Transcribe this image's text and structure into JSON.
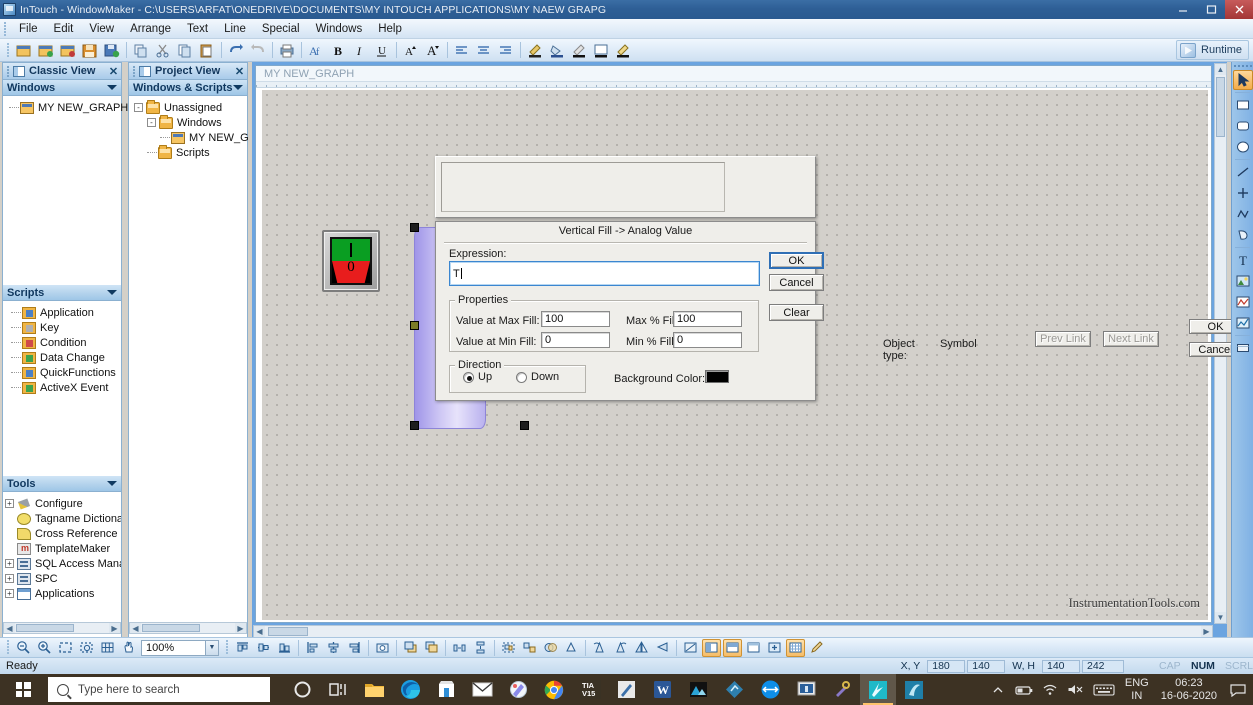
{
  "window": {
    "title": "InTouch - WindowMaker - C:\\USERS\\ARFAT\\ONEDRIVE\\DOCUMENTS\\MY INTOUCH APPLICATIONS\\MY NAEW GRAPG",
    "minimize": "–",
    "maximize": "❐",
    "close": "✕"
  },
  "menu": {
    "items": [
      "File",
      "Edit",
      "View",
      "Arrange",
      "Text",
      "Line",
      "Special",
      "Windows",
      "Help"
    ]
  },
  "toolbar": {
    "runtime_label": "Runtime",
    "icons": [
      "new-window-icon",
      "open-window-icon",
      "close-window-icon",
      "save-icon",
      "save-all-icon",
      "duplicate-icon",
      "cut-icon",
      "copy-icon",
      "paste-icon",
      "undo-icon",
      "redo-icon",
      "print-icon",
      "font-icon",
      "bold-icon",
      "italic-icon",
      "underline-icon",
      "increase-font-icon",
      "decrease-font-icon",
      "align-left-icon",
      "align-center-icon",
      "align-right-icon",
      "line-color-icon",
      "fill-color-icon",
      "text-color-icon",
      "window-color-icon",
      "highlight-color-icon"
    ]
  },
  "classic_view": {
    "caption": "Classic View",
    "close": "✕",
    "section": "Windows",
    "items": [
      {
        "label": "MY NEW_GRAPH",
        "icon": "window-doc-icon"
      }
    ]
  },
  "project_view": {
    "caption": "Project View",
    "close": "✕",
    "section": "Windows & Scripts",
    "tree": [
      {
        "label": "Unassigned",
        "icon": "folder-icon",
        "depth": 0,
        "expander": "-"
      },
      {
        "label": "Windows",
        "icon": "folder-icon",
        "depth": 1,
        "expander": "-"
      },
      {
        "label": "MY NEW_G",
        "icon": "window-doc-icon",
        "depth": 2,
        "expander": ""
      },
      {
        "label": "Scripts",
        "icon": "folder-icon",
        "depth": 1,
        "expander": ""
      }
    ]
  },
  "scripts_panel": {
    "section": "Scripts",
    "items": [
      {
        "label": "Application",
        "icon": "script-application-icon"
      },
      {
        "label": "Key",
        "icon": "script-key-icon"
      },
      {
        "label": "Condition",
        "icon": "script-condition-icon"
      },
      {
        "label": "Data Change",
        "icon": "script-data-change-icon"
      },
      {
        "label": "QuickFunctions",
        "icon": "script-quickfunctions-icon"
      },
      {
        "label": "ActiveX Event",
        "icon": "script-activex-event-icon"
      }
    ]
  },
  "tools_panel": {
    "section": "Tools",
    "items": [
      {
        "label": "Configure",
        "icon": "configure-icon",
        "expander": "+"
      },
      {
        "label": "Tagname Dictiona",
        "icon": "tagname-dictionary-icon",
        "expander": ""
      },
      {
        "label": "Cross Reference",
        "icon": "cross-reference-icon",
        "expander": ""
      },
      {
        "label": "TemplateMaker",
        "icon": "template-maker-icon",
        "expander": ""
      },
      {
        "label": "SQL Access Mana",
        "icon": "sql-access-manager-icon",
        "expander": "+"
      },
      {
        "label": "SPC",
        "icon": "spc-icon",
        "expander": "+"
      },
      {
        "label": "Applications",
        "icon": "applications-icon",
        "expander": "+"
      }
    ]
  },
  "canvas": {
    "child_window_title": "MY NEW_GRAPH",
    "watermark": "InstrumentationTools.com",
    "switch_symbol": {
      "on_label": "I",
      "off_label": "0",
      "on_color": "#0a9e22",
      "off_color": "#e81d1d"
    },
    "tank_symbol": {
      "name": "vertical-fill-tank",
      "fill_color": "#b9b1ee"
    }
  },
  "object_dialog": {
    "object_type_label": "Object type:",
    "object_type_value": "Symbol",
    "prev_link": "Prev Link",
    "next_link": "Next Link",
    "ok": "OK",
    "cancel": "Cancel"
  },
  "fill_dialog": {
    "title": "Vertical Fill -> Analog Value",
    "expression_label": "Expression:",
    "expression_value": "T",
    "ok": "OK",
    "cancel": "Cancel",
    "clear": "Clear",
    "properties_group": "Properties",
    "value_at_max_fill_label": "Value at Max Fill:",
    "value_at_max_fill": "100",
    "max_pct_fill_label": "Max % Fill:",
    "max_pct_fill": "100",
    "value_at_min_fill_label": "Value at Min Fill:",
    "value_at_min_fill": "0",
    "min_pct_fill_label": "Min % Fill:",
    "min_pct_fill": "0",
    "direction_group": "Direction",
    "direction_up": "Up",
    "direction_down": "Down",
    "direction_selected": "Up",
    "background_color_label": "Background Color:",
    "background_color": "#000000"
  },
  "toolbox": {
    "tools": [
      {
        "name": "select-arrow-tool",
        "selected": true
      },
      {
        "name": "rectangle-tool",
        "selected": false
      },
      {
        "name": "rounded-rectangle-tool",
        "selected": false
      },
      {
        "name": "ellipse-tool",
        "selected": false
      },
      {
        "name": "line-tool",
        "selected": false
      },
      {
        "name": "h-v-line-tool",
        "selected": false
      },
      {
        "name": "polyline-tool",
        "selected": false
      },
      {
        "name": "polygon-tool",
        "selected": false
      },
      {
        "name": "text-tool",
        "selected": false
      },
      {
        "name": "bitmap-tool",
        "selected": false
      },
      {
        "name": "real-time-trend-tool",
        "selected": false
      },
      {
        "name": "historical-trend-tool",
        "selected": false
      },
      {
        "name": "button-tool",
        "selected": false
      }
    ]
  },
  "bottom_toolbar": {
    "zoom_value": "100%",
    "icons": [
      "zoom-out-icon",
      "zoom-in-icon",
      "zoom-fit-icon",
      "zoom-selection-icon",
      "grid-icon",
      "pan-icon",
      "align-top-icon",
      "align-middle-icon",
      "align-bottom-icon",
      "align-left-icon",
      "align-center-icon",
      "align-right-icon",
      "snapshot-icon",
      "send-to-back-icon",
      "bring-to-front-icon",
      "space-horizontal-icon",
      "space-vertical-icon",
      "group-icon",
      "ungroup-icon",
      "merge-icon",
      "break-icon",
      "rotate-left-icon",
      "rotate-right-icon",
      "flip-horizontal-icon",
      "flip-vertical-icon",
      "edit-points-icon",
      "tile-vertical-icon",
      "tile-horizontal-icon",
      "window-icon",
      "center-icon",
      "show-grid-icon",
      "pencil-icon"
    ]
  },
  "statusbar": {
    "ready": "Ready",
    "xy_label": "X, Y",
    "x": "180",
    "y": "140",
    "wh_label": "W, H",
    "w": "140",
    "h": "242",
    "caps": "CAP",
    "num": "NUM",
    "scrl": "SCRL"
  },
  "taskbar": {
    "search_placeholder": "Type here to search",
    "apps": [
      {
        "name": "cortana-icon",
        "active": false
      },
      {
        "name": "task-view-icon",
        "active": false
      },
      {
        "name": "file-explorer-icon",
        "active": false
      },
      {
        "name": "microsoft-edge-icon",
        "active": false
      },
      {
        "name": "microsoft-store-icon",
        "active": false
      },
      {
        "name": "mail-icon",
        "active": false
      },
      {
        "name": "paint-net-icon",
        "active": false
      },
      {
        "name": "google-chrome-icon",
        "active": false
      },
      {
        "name": "tia-portal-v15-icon",
        "active": false
      },
      {
        "name": "snipping-tool-icon",
        "active": false
      },
      {
        "name": "microsoft-word-icon",
        "active": false
      },
      {
        "name": "photos-icon",
        "active": false
      },
      {
        "name": "sketch-icon",
        "active": false
      },
      {
        "name": "teamviewer-icon",
        "active": false
      },
      {
        "name": "remote-desktop-icon",
        "active": false
      },
      {
        "name": "tools-icon",
        "active": false
      },
      {
        "name": "intouch-windowmaker-icon",
        "active": true
      },
      {
        "name": "intouch-app-icon",
        "active": false
      }
    ],
    "tray": {
      "chevron": "∧",
      "battery": "battery-icon",
      "wifi": "wifi-icon",
      "volume": "volume-mute-icon",
      "keyboard": "keyboard-icon",
      "lang_line1": "ENG",
      "lang_line2": "IN",
      "time": "06:23",
      "date": "16-06-2020",
      "notifications": "notification-icon"
    }
  }
}
